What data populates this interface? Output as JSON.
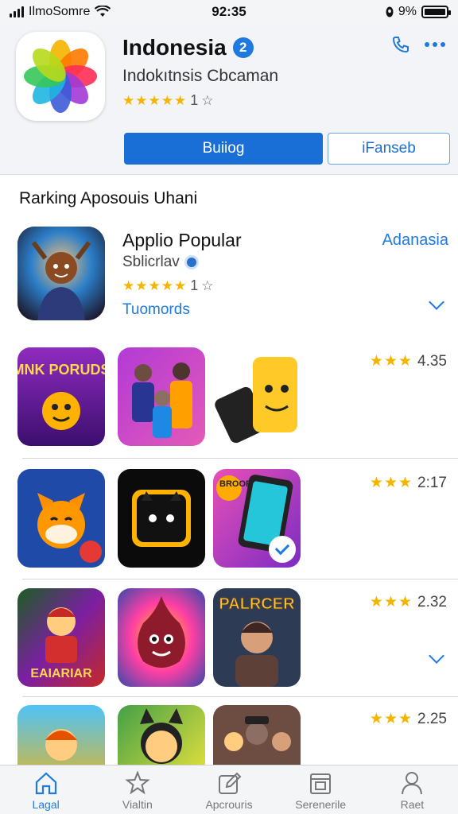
{
  "status_bar": {
    "carrier": "IlmoSomre",
    "time": "92:35",
    "battery": "9%"
  },
  "header": {
    "title": "Indonesia",
    "verified_badge": "2",
    "subtitle": "Indokıtnsis Cbcaman",
    "stars": "★★★★★",
    "rating_count": "1",
    "primary_button": "Buiiog",
    "secondary_button": "iFanseb",
    "icons": {
      "phone": "phone-icon",
      "more": "more-icon"
    }
  },
  "section": {
    "title": "Rarking Aposouis Uhani"
  },
  "featured": {
    "title": "Applio Popular",
    "developer": "Sblicrlav",
    "stars": "★★★★★",
    "rating_count": "1",
    "link": "Tuomords",
    "action": "Adanasia"
  },
  "rows": [
    {
      "rating_stars": "★★★",
      "rating_value": "4.35",
      "apps": [
        {
          "label": "MNK PORUDS",
          "color_top": "#8f2bbf",
          "color_bottom": "#3b0f6e"
        },
        {
          "label": "",
          "color_top": "#b23ad6",
          "color_bottom": "#e45ab8"
        },
        {
          "label": "",
          "color_top": "#ffffff",
          "color_bottom": "#f2f2f2"
        }
      ]
    },
    {
      "rating_stars": "★★★",
      "rating_value": "2:17",
      "apps": [
        {
          "label": "",
          "color_top": "#1f4aa8",
          "color_bottom": "#143277"
        },
        {
          "label": "",
          "color_top": "#0b0b0b",
          "color_bottom": "#1a1a1a"
        },
        {
          "label": "BROOR",
          "color_top": "#e84fb6",
          "color_bottom": "#7b2cc4"
        }
      ]
    },
    {
      "rating_stars": "★★★",
      "rating_value": "2.32",
      "apps": [
        {
          "label": "EAIARIAR",
          "color_top": "#1b5e20",
          "color_bottom": "#c62828"
        },
        {
          "label": "",
          "color_top": "#ff3fa4",
          "color_bottom": "#ffd600"
        },
        {
          "label": "PALRCER",
          "color_top": "#2e3b55",
          "color_bottom": "#5d4037"
        }
      ]
    },
    {
      "rating_stars": "★★★",
      "rating_value": "2.25",
      "apps": [
        {
          "label": "",
          "color_top": "#4fc3f7",
          "color_bottom": "#ffb300"
        },
        {
          "label": "",
          "color_top": "#43a047",
          "color_bottom": "#ffeb3b"
        },
        {
          "label": "",
          "color_top": "#6d4c41",
          "color_bottom": "#8d6e63"
        }
      ]
    }
  ],
  "tabs": [
    {
      "label": "Lagal",
      "icon": "home-icon",
      "active": true
    },
    {
      "label": "Vialtin",
      "icon": "star-icon",
      "active": false
    },
    {
      "label": "Apcrouris",
      "icon": "edit-icon",
      "active": false
    },
    {
      "label": "Serenerile",
      "icon": "calendar-icon",
      "active": false
    },
    {
      "label": "Raet",
      "icon": "person-icon",
      "active": false
    }
  ],
  "colors": {
    "accent": "#1f7ae0",
    "star": "#f4b400",
    "primary_button": "#1a6fd6"
  }
}
